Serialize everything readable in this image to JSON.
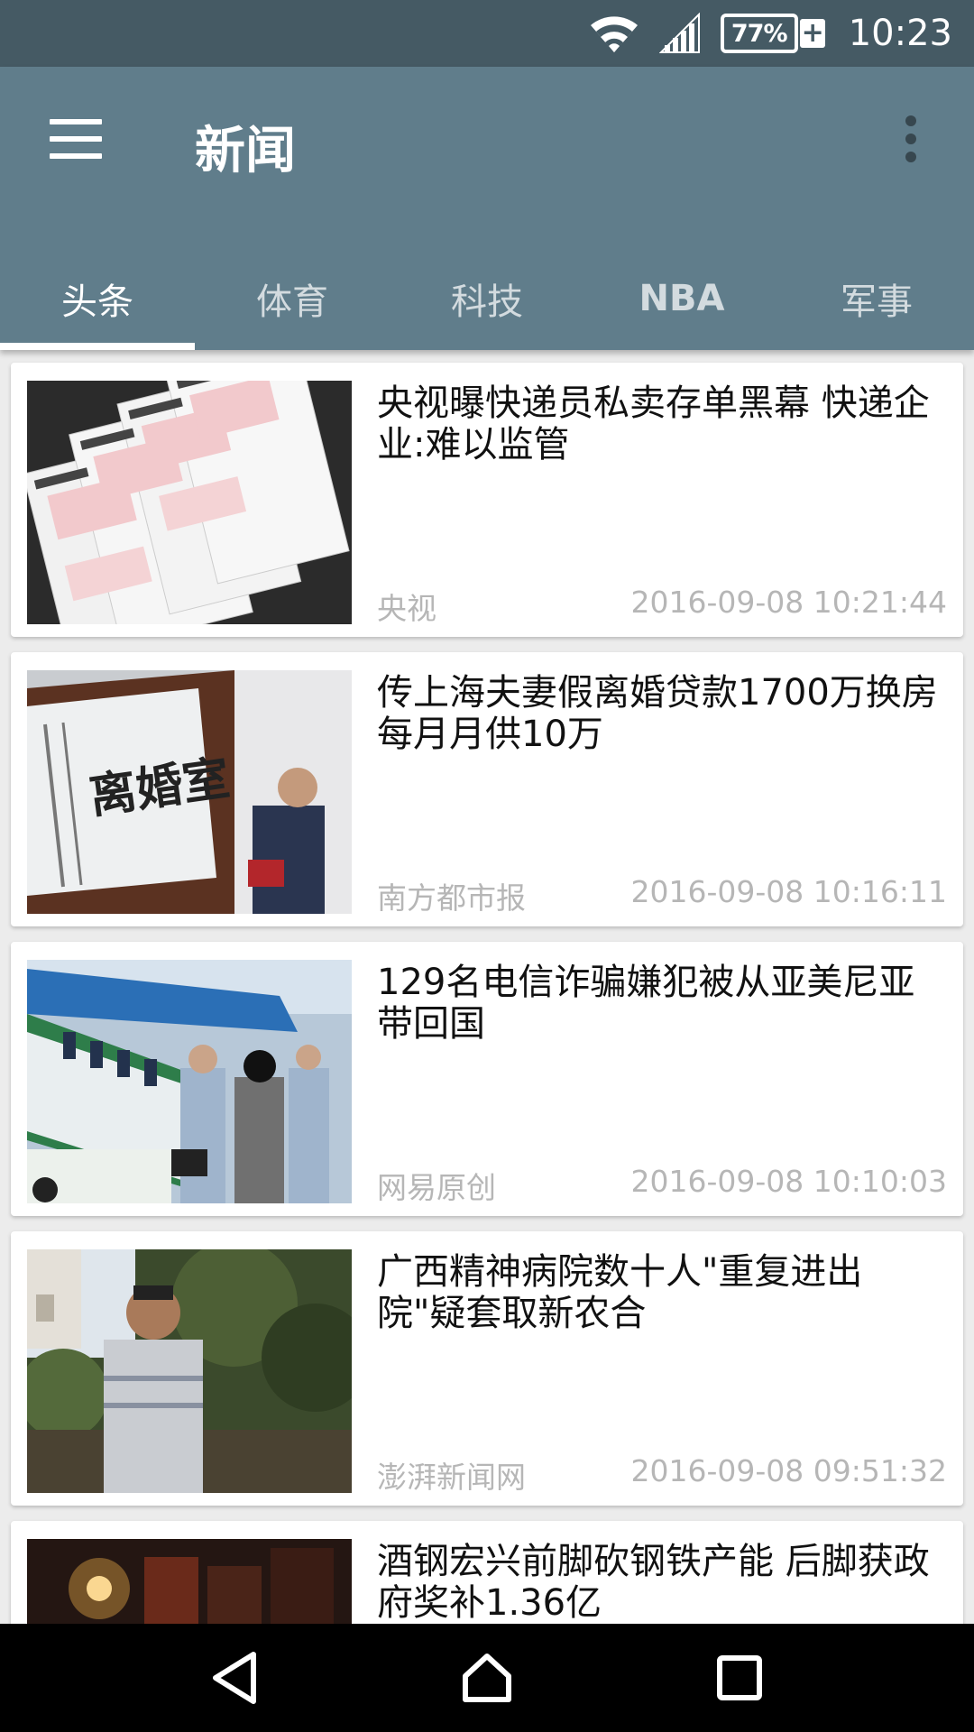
{
  "status": {
    "battery": "77%",
    "battery_charge_symbol": "+",
    "time": "10:23",
    "icons": [
      "wifi-icon",
      "signal-icon",
      "battery-icon"
    ]
  },
  "appbar": {
    "title": "新闻",
    "menu_icon": "hamburger-menu-icon",
    "overflow_icon": "more-vert-icon"
  },
  "tabs": [
    {
      "label": "头条",
      "active": true
    },
    {
      "label": "体育"
    },
    {
      "label": "科技"
    },
    {
      "label": "NBA"
    },
    {
      "label": "军事"
    }
  ],
  "news": [
    {
      "title": "央视曝快递员私卖存单黑幕 快递企业:难以监管",
      "source": "央视",
      "time": "2016-09-08 10:21:44"
    },
    {
      "title": "传上海夫妻假离婚贷款1700万换房 每月月供10万",
      "source": "南方都市报",
      "time": "2016-09-08 10:16:11"
    },
    {
      "title": "129名电信诈骗嫌犯被从亚美尼亚带回国",
      "source": "网易原创",
      "time": "2016-09-08 10:10:03"
    },
    {
      "title": "广西精神病院数十人\"重复进出院\"疑套取新农合",
      "source": "澎湃新闻网",
      "time": "2016-09-08 09:51:32"
    },
    {
      "title": "酒钢宏兴前脚砍钢铁产能 后脚获政府奖补1.36亿",
      "source": "",
      "time": ""
    }
  ],
  "thumb_text": {
    "divorce_sign": "离婚室"
  },
  "navbar": {
    "icons": [
      "back-icon",
      "home-icon",
      "recents-icon"
    ]
  },
  "colors": {
    "status_bar": "#455a64",
    "app_bar": "#607d8b",
    "background": "#ececec",
    "meta_text": "#b6b6b6"
  }
}
